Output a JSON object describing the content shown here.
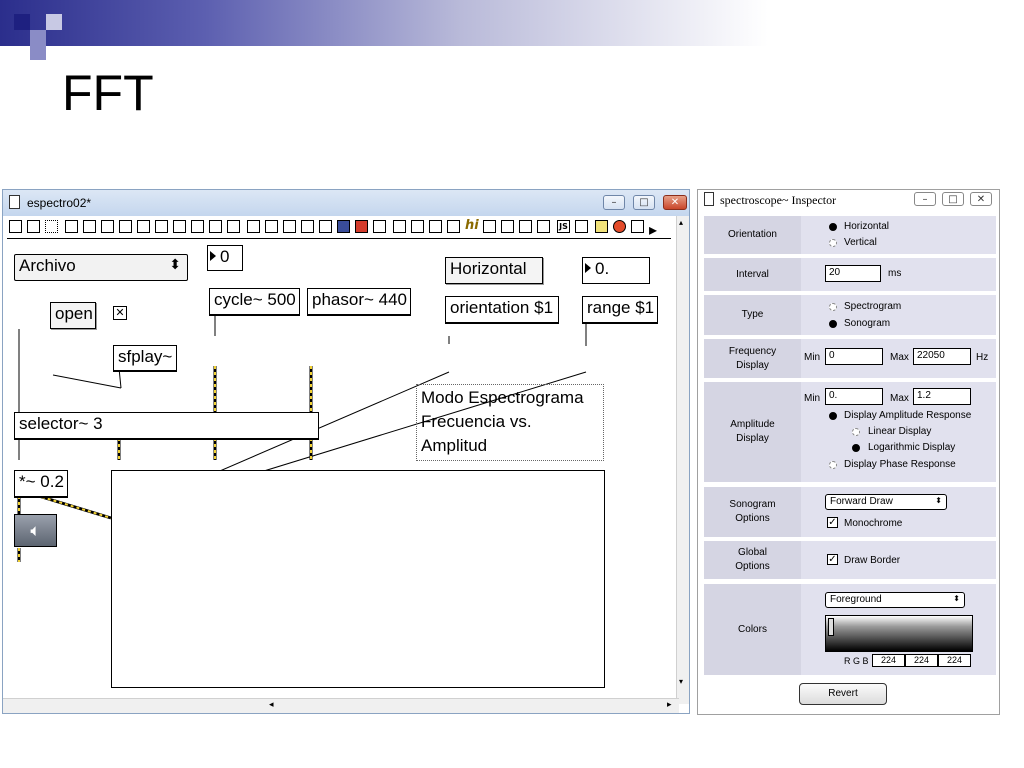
{
  "slide": {
    "title": "FFT"
  },
  "patcher": {
    "window_title": "espectro02*",
    "objects": {
      "archivo_menu": "Archivo",
      "number_zero": "0",
      "number_float": "0.",
      "message_open": "open",
      "message_horizontal": "Horizontal",
      "cycle": "cycle~ 500",
      "phasor": "phasor~ 440",
      "orientation": "orientation $1",
      "range": "range $1",
      "sfplay": "sfplay~",
      "selector": "selector~ 3",
      "gain": "*~ 0.2",
      "comment_lines": [
        "Modo Espectrograma",
        "Frecuencia vs.",
        "Amplitud"
      ]
    }
  },
  "inspector": {
    "title": "spectroscope~ Inspector",
    "orientation": {
      "label": "Orientation",
      "options": [
        "Horizontal",
        "Vertical"
      ],
      "selected": "Horizontal"
    },
    "interval": {
      "label": "Interval",
      "value": "20",
      "unit": "ms"
    },
    "type": {
      "label": "Type",
      "options": [
        "Spectrogram",
        "Sonogram"
      ],
      "selected": "Sonogram"
    },
    "frequency": {
      "label_1": "Frequency",
      "label_2": "Display",
      "min_label": "Min",
      "min": "0",
      "max_label": "Max",
      "max": "22050",
      "unit": "Hz"
    },
    "amplitude": {
      "label_1": "Amplitude",
      "label_2": "Display",
      "min_label": "Min",
      "min": "0.",
      "max_label": "Max",
      "max": "1.2",
      "response_amplitude": "Display Amplitude Response",
      "linear": "Linear Display",
      "log": "Logarithmic Display",
      "response_phase": "Display Phase Response"
    },
    "sonogram": {
      "label_1": "Sonogram",
      "label_2": "Options",
      "draw_mode": "Forward Draw",
      "monochrome": "Monochrome"
    },
    "global": {
      "label_1": "Global",
      "label_2": "Options",
      "draw_border": "Draw Border"
    },
    "colors": {
      "label": "Colors",
      "target": "Foreground",
      "rgb_label": "R G B",
      "r": "224",
      "g": "224",
      "b": "224"
    },
    "revert": "Revert"
  }
}
